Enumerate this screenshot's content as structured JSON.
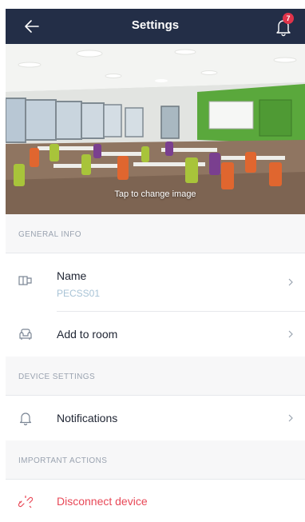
{
  "header": {
    "title": "Settings",
    "notification_count": "7"
  },
  "hero": {
    "caption": "Tap to change image"
  },
  "sections": {
    "general": "GENERAL INFO",
    "device": "DEVICE SETTINGS",
    "actions": "IMPORTANT ACTIONS"
  },
  "items": {
    "name_label": "Name",
    "name_value": "PECSS01",
    "room_label": "Add to room",
    "notifications_label": "Notifications",
    "disconnect_label": "Disconnect device"
  },
  "colors": {
    "header": "#232e47",
    "danger": "#e84857",
    "badge": "#e0334a"
  }
}
